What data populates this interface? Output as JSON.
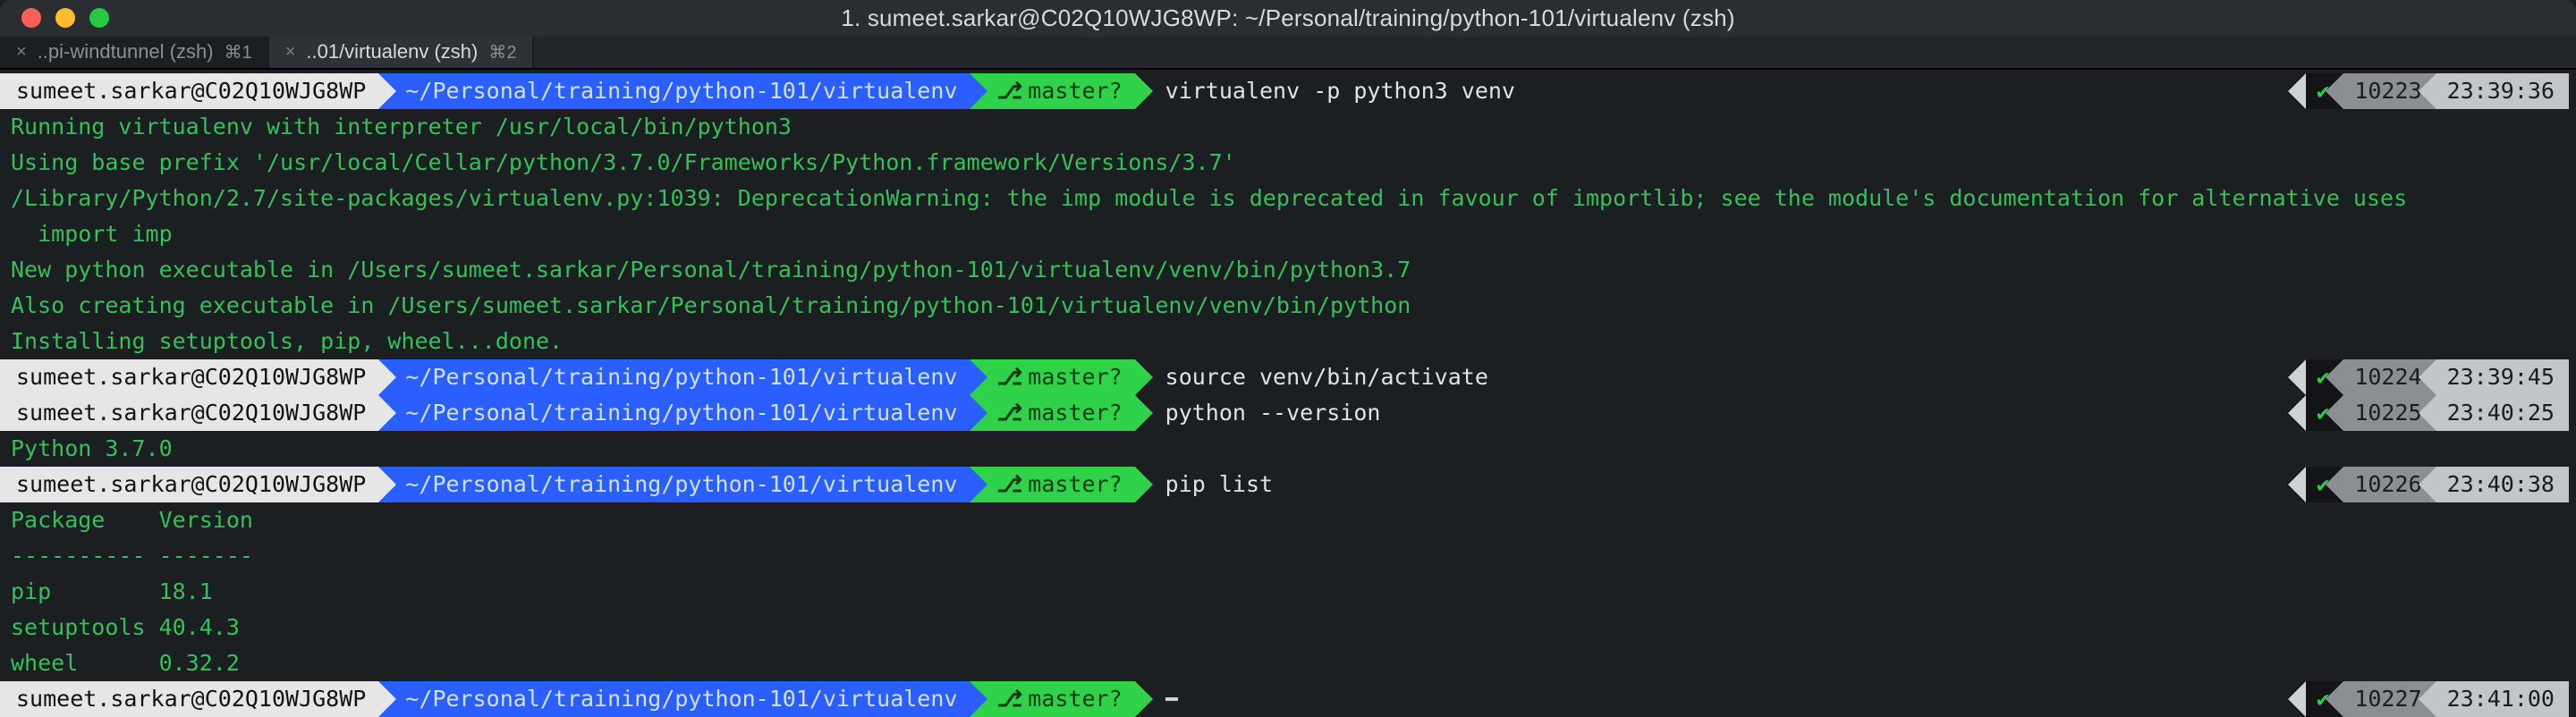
{
  "window": {
    "title": "1. sumeet.sarkar@C02Q10WJG8WP: ~/Personal/training/python-101/virtualenv (zsh)"
  },
  "tabs": [
    {
      "close": "×",
      "label": "..pi-windtunnel (zsh)",
      "shortcut": "⌘1"
    },
    {
      "close": "×",
      "label": "..01/virtualenv (zsh)",
      "shortcut": "⌘2"
    }
  ],
  "userhost": "sumeet.sarkar@C02Q10WJG8WP",
  "path": "~/Personal/training/python-101/virtualenv",
  "git": {
    "branch": "master",
    "flag": "?"
  },
  "cmds": {
    "c1": "virtualenv -p python3 venv",
    "c2": "source venv/bin/activate",
    "c3": "python --version",
    "c4": "pip list"
  },
  "right": {
    "r1": {
      "hist": "10223",
      "time": "23:39:36"
    },
    "r2": {
      "hist": "10224",
      "time": "23:39:45"
    },
    "r3": {
      "hist": "10225",
      "time": "23:40:25"
    },
    "r4": {
      "hist": "10226",
      "time": "23:40:38"
    },
    "r5": {
      "hist": "10227",
      "time": "23:41:00"
    }
  },
  "output": {
    "o1": "Running virtualenv with interpreter /usr/local/bin/python3",
    "o2": "Using base prefix '/usr/local/Cellar/python/3.7.0/Frameworks/Python.framework/Versions/3.7'",
    "o3": "/Library/Python/2.7/site-packages/virtualenv.py:1039: DeprecationWarning: the imp module is deprecated in favour of importlib; see the module's documentation for alternative uses",
    "o4": "  import imp",
    "o5": "New python executable in /Users/sumeet.sarkar/Personal/training/python-101/virtualenv/venv/bin/python3.7",
    "o6": "Also creating executable in /Users/sumeet.sarkar/Personal/training/python-101/virtualenv/venv/bin/python",
    "o7": "Installing setuptools, pip, wheel...done.",
    "pyver": "Python 3.7.0",
    "pkg_header": "Package    Version",
    "pkg_sep": "---------- -------",
    "pkg1": "pip        18.1",
    "pkg2": "setuptools 40.4.3",
    "pkg3": "wheel      0.32.2"
  }
}
